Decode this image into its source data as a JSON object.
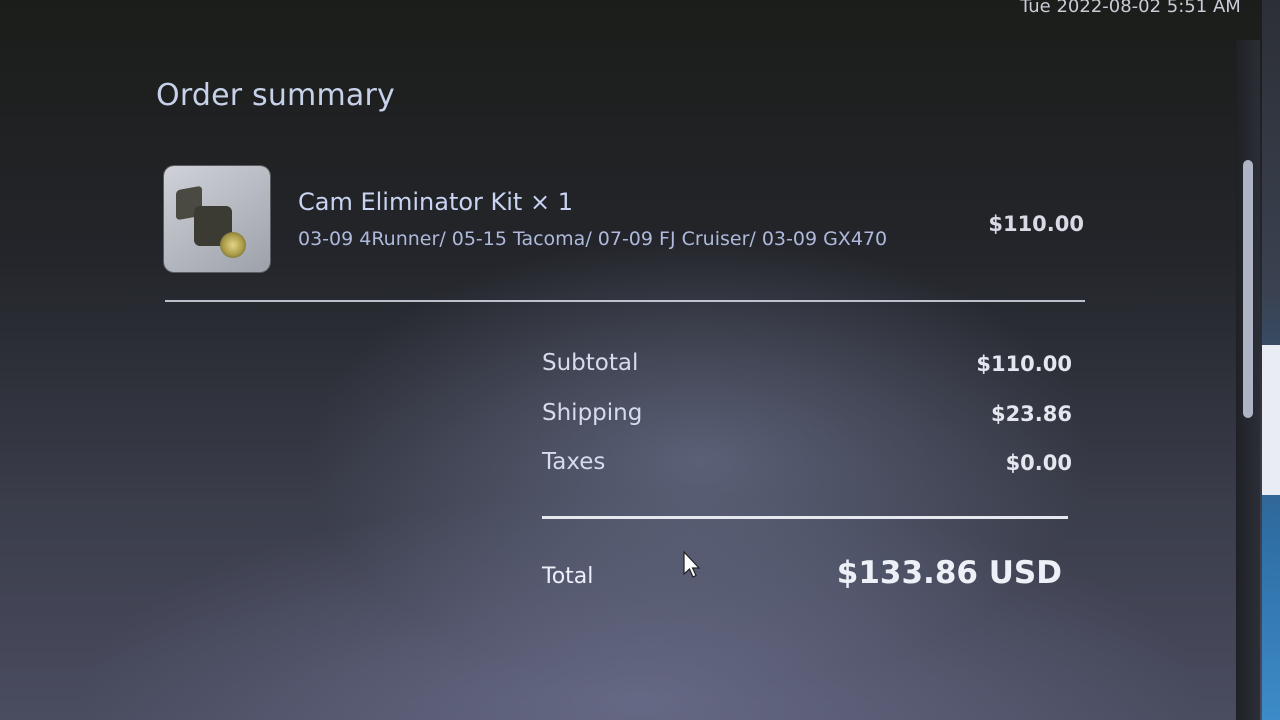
{
  "header": {
    "timestamp": "Tue 2022-08-02 5:51 AM"
  },
  "order_summary": {
    "title": "Order summary",
    "item": {
      "name": "Cam Eliminator Kit × 1",
      "description": "03-09 4Runner/ 05-15 Tacoma/ 07-09 FJ Cruiser/ 03-09 GX470",
      "price": "$110.00",
      "image_icon": "product-thumbnail"
    },
    "summary_rows": [
      {
        "label": "Subtotal",
        "value": "$110.00"
      },
      {
        "label": "Shipping",
        "value": "$23.86"
      },
      {
        "label": "Taxes",
        "value": "$0.00"
      }
    ],
    "total": {
      "label": "Total",
      "value": "$133.86 USD"
    }
  },
  "colors": {
    "background_dark": "#1b1d1a",
    "text_primary": "#e6e9f2",
    "text_accent": "#c7d1ea"
  }
}
